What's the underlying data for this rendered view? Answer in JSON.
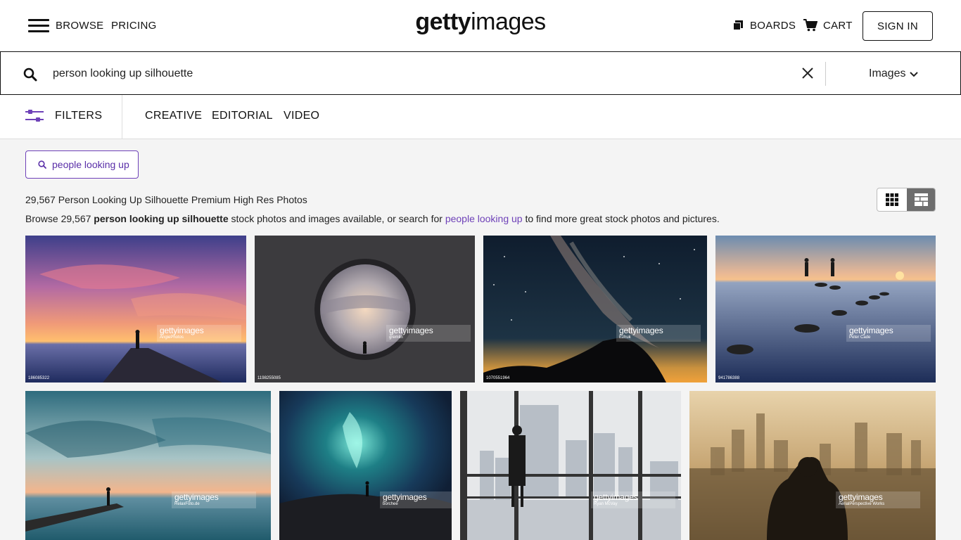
{
  "header": {
    "browse": "BROWSE",
    "pricing": "PRICING",
    "logo_bold": "getty",
    "logo_light": "images",
    "boards": "BOARDS",
    "cart": "CART",
    "sign_in": "SIGN IN"
  },
  "search": {
    "query": "person looking up silhouette",
    "type": "Images"
  },
  "filters": {
    "label": "FILTERS",
    "tabs": [
      "CREATIVE",
      "EDITORIAL",
      "VIDEO"
    ]
  },
  "suggestion": "people looking up",
  "results": {
    "title": "29,567 Person Looking Up Silhouette Premium High Res Photos",
    "desc_prefix": "Browse 29,567 ",
    "desc_bold": "person looking up silhouette",
    "desc_middle": " stock photos and images available, or search for ",
    "desc_link": "people looking up",
    "desc_suffix": " to find more great stock photos and pictures."
  },
  "images": [
    {
      "id": "186085322",
      "credit": "AngiePhotos",
      "brand": "gettyimages"
    },
    {
      "id": "1198255085",
      "credit": "gremlin",
      "brand": "gettyimages"
    },
    {
      "id": "1070551964",
      "credit": "Ezhuk",
      "brand": "gettyimages"
    },
    {
      "id": "941786388",
      "credit": "Peter Cade",
      "brand": "gettyimages"
    },
    {
      "id": "",
      "credit": "RelaxFoto.de",
      "brand": "gettyimages"
    },
    {
      "id": "",
      "credit": "borchee",
      "brand": "gettyimages"
    },
    {
      "id": "",
      "credit": "Ryan McVay",
      "brand": "gettyimages"
    },
    {
      "id": "",
      "credit": "AerialPerspective Works",
      "brand": "gettyimages"
    }
  ],
  "colors": {
    "accent": "#6e41b8",
    "page_bg": "#f4f4f4"
  }
}
